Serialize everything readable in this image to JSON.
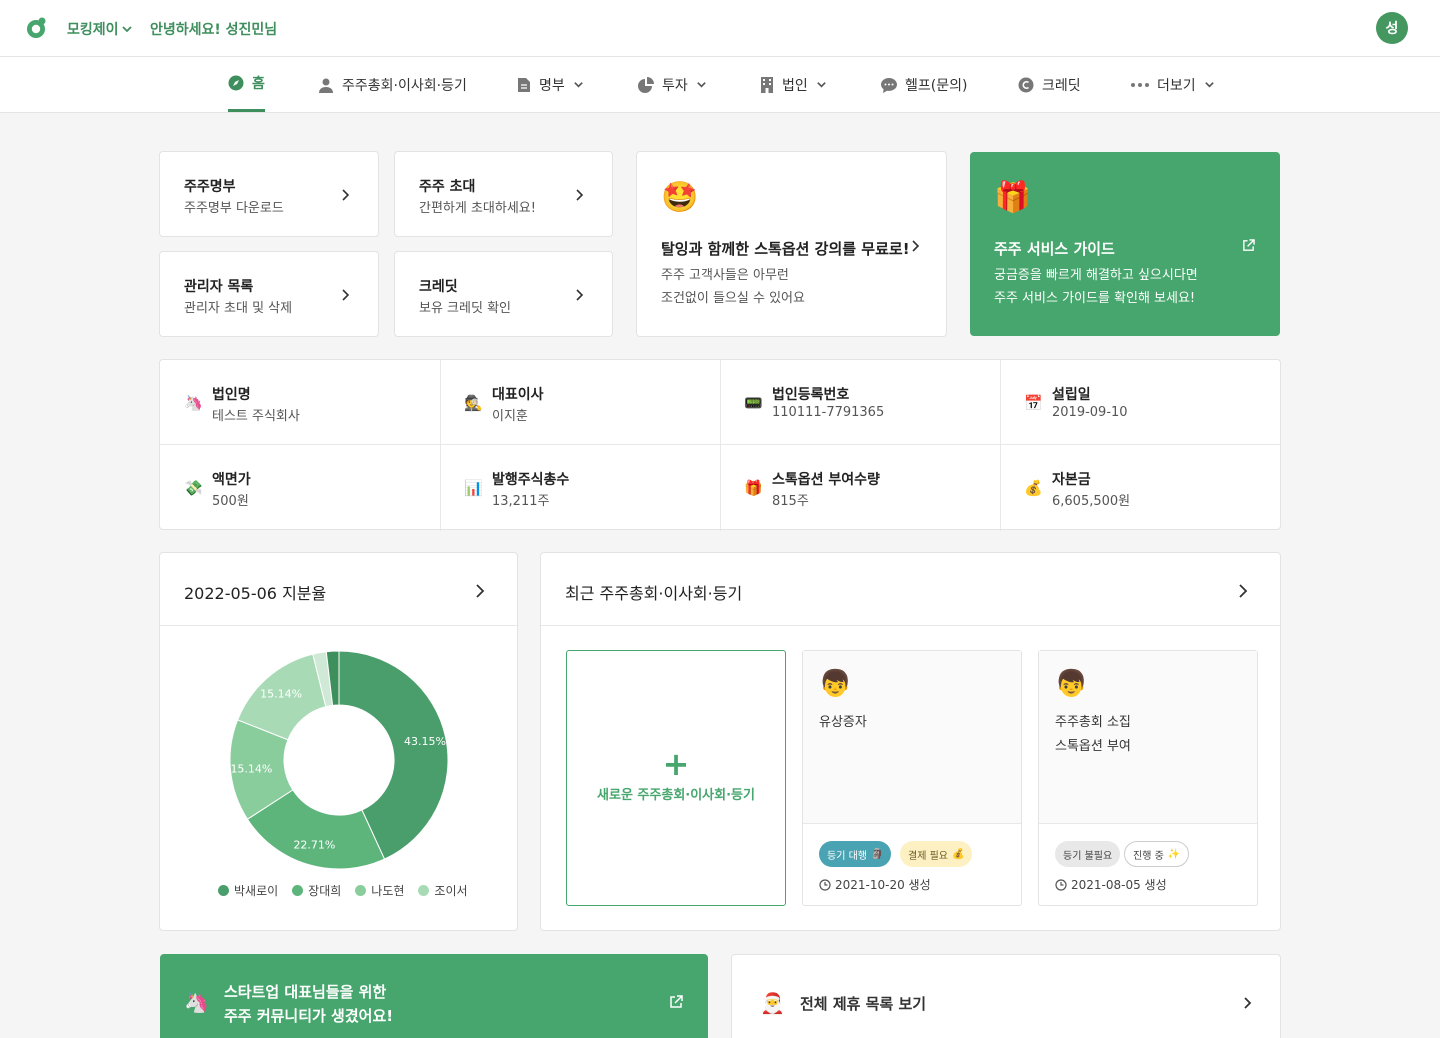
{
  "header": {
    "company": "모킹제이",
    "greeting": "안녕하세요! 성진민님",
    "avatar_initial": "성"
  },
  "nav": {
    "items": [
      {
        "label": "홈",
        "icon": "compass-icon"
      },
      {
        "label": "주주총회·이사회·등기",
        "icon": "person-icon"
      },
      {
        "label": "명부",
        "icon": "document-icon"
      },
      {
        "label": "투자",
        "icon": "pie-chart-icon"
      },
      {
        "label": "법인",
        "icon": "building-icon"
      },
      {
        "label": "헬프(문의)",
        "icon": "chat-icon"
      },
      {
        "label": "크레딧",
        "icon": "credit-coin-icon"
      },
      {
        "label": "더보기",
        "icon": "more-dots-icon"
      }
    ]
  },
  "quick_cards": [
    {
      "title": "주주명부",
      "subtitle": "주주명부 다운로드"
    },
    {
      "title": "주주 초대",
      "subtitle": "간편하게 초대하세요!"
    },
    {
      "title": "관리자 목록",
      "subtitle": "관리자 초대 및 삭제"
    },
    {
      "title": "크레딧",
      "subtitle": "보유 크레딧 확인"
    }
  ],
  "promo": {
    "emoji": "🤩",
    "title": "탈잉과 함께한 스톡옵션 강의를 무료로!",
    "body": "주주 고객사들은 아무런\n조건없이 들으실 수 있어요"
  },
  "guide": {
    "emoji": "🎁",
    "title": "주주 서비스 가이드",
    "body": "궁금증을 빠르게 해결하고 싶으시다면\n주주 서비스 가이드를 확인해 보세요!"
  },
  "company_info": [
    {
      "icon": "🦄",
      "label": "법인명",
      "value": "테스트 주식회사"
    },
    {
      "icon": "🕵",
      "label": "대표이사",
      "value": "이지훈"
    },
    {
      "icon": "📟",
      "label": "법인등록번호",
      "value": "110111-7791365"
    },
    {
      "icon": "📅",
      "label": "설립일",
      "value": "2019-09-10"
    },
    {
      "icon": "💸",
      "label": "액면가",
      "value": "500원"
    },
    {
      "icon": "📊",
      "label": "발행주식총수",
      "value": "13,211주"
    },
    {
      "icon": "🎁",
      "label": "스톡옵션 부여수량",
      "value": "815주"
    },
    {
      "icon": "💰",
      "label": "자본금",
      "value": "6,605,500원"
    }
  ],
  "ownership": {
    "title": "2022-05-06 지분율"
  },
  "chart_data": {
    "type": "pie",
    "donut": true,
    "legend_position": "bottom",
    "series": [
      {
        "name": "박새로이",
        "value": 43.15,
        "label": "43.15%",
        "color": "#4a9e6b"
      },
      {
        "name": "장대희",
        "value": 22.71,
        "label": "22.71%",
        "color": "#5db57c"
      },
      {
        "name": "나도현",
        "value": 15.14,
        "label": "15.14%",
        "color": "#8acd9c"
      },
      {
        "name": "조이서",
        "value": 15.14,
        "label": "15.14%",
        "color": "#a8dbb5"
      },
      {
        "name": "",
        "value": 2.0,
        "label": "",
        "color": "#cfe9d6"
      },
      {
        "name": "",
        "value": 1.86,
        "label": "",
        "color": "#3d8f5c"
      }
    ]
  },
  "meetings": {
    "title": "최근 주주총회·이사회·등기",
    "new_label": "새로운 주주총회·이사회·등기",
    "items": [
      {
        "emoji": "👦",
        "lines": "유상증자",
        "badges": [
          {
            "label": "등기 대행",
            "emoji": "🗿"
          },
          {
            "label": "결제 필요",
            "emoji": "💰"
          }
        ],
        "date": "2021-10-20 생성"
      },
      {
        "emoji": "👦",
        "lines": "주주총회 소집\n스톡옵션 부여",
        "badges": [
          {
            "label": "등기 불필요",
            "emoji": ""
          },
          {
            "label": "진행 중",
            "emoji": "✨"
          }
        ],
        "date": "2021-08-05 생성"
      }
    ]
  },
  "community": {
    "emoji": "🦄",
    "title": "스타트업 대표님들을 위한\n주주 커뮤니티가 생겼어요!"
  },
  "partner": {
    "emoji": "🎅",
    "title": "전체 제휴 목록 보기"
  },
  "colors": {
    "brand": "#46a66d",
    "brand_text": "#3f8f5e"
  }
}
